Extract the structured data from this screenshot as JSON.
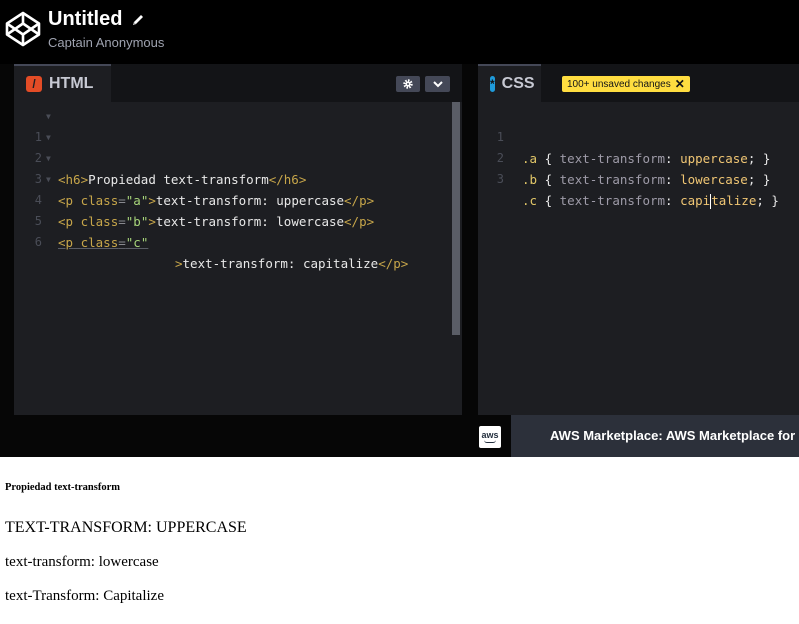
{
  "header": {
    "title": "Untitled",
    "author": "Captain Anonymous"
  },
  "html_pane": {
    "tab_label": "HTML",
    "line_numbers": [
      "1",
      "2",
      "3",
      "4",
      "5",
      "6"
    ],
    "lines": [
      {
        "tag_open": "<h6>",
        "text": "Propiedad text-transform",
        "tag_close": "</h6>"
      },
      {
        "tag_open": "<p",
        "attr": "class",
        "eq": "=",
        "value": "\"a\"",
        "gt": ">",
        "text": "text-transform: uppercase",
        "tag_close": "</p>"
      },
      {
        "tag_open": "<p",
        "attr": "class",
        "eq": "=",
        "value": "\"b\"",
        "gt": ">",
        "text": "text-transform: lowercase",
        "tag_close": "</p>"
      },
      {
        "tag_open": "<p",
        "attr": "class",
        "eq": "=",
        "value": "\"c\"",
        "gt": ">",
        "text": "text-transform: capitalize",
        "tag_close": "</p>"
      }
    ]
  },
  "css_pane": {
    "tab_label": "CSS",
    "badge": "100+ unsaved changes",
    "line_numbers": [
      "1",
      "2",
      "3"
    ],
    "lines": [
      {
        "sel": ".a",
        "ob": "{",
        "prop": "text-transform",
        "colon": ":",
        "val": "uppercase",
        "semi": ";",
        "cb": "}"
      },
      {
        "sel": ".b",
        "ob": "{",
        "prop": "text-transform",
        "colon": ":",
        "val": "lowercase",
        "semi": ";",
        "cb": "}"
      },
      {
        "sel": ".c",
        "ob": "{",
        "prop": "text-transform",
        "colon": ":",
        "val_a": "capi",
        "val_b": "talize",
        "semi": ";",
        "cb": "}"
      }
    ]
  },
  "ad": {
    "logo": "aws",
    "text": "AWS Marketplace: AWS Marketplace for B"
  },
  "preview": {
    "heading": "Propiedad text-transform",
    "p_a": "text-transform: uppercase",
    "p_b": "text-transform: lowercase",
    "p_c": "text-transform: capitalize"
  },
  "colors": {
    "header_bg": "#000000",
    "editor_bg": "#1d1e22",
    "html_accent": "#e34c26",
    "css_accent": "#1f9bdb",
    "badge_bg": "#ffdd40"
  },
  "icons": [
    "codepen-logo-icon",
    "pencil-icon",
    "gear-icon",
    "chevron-down-icon",
    "close-icon",
    "aws-logo-icon"
  ]
}
